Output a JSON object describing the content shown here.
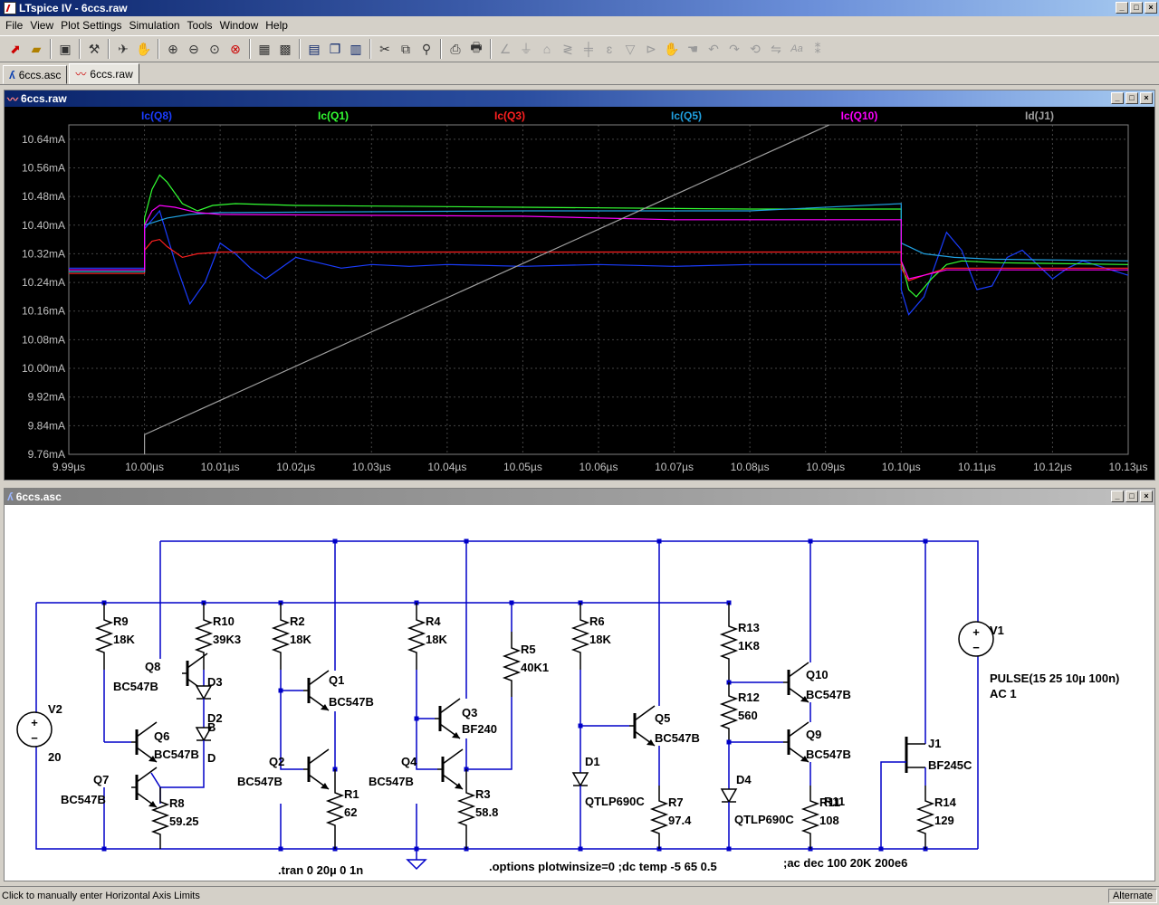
{
  "app": {
    "title": "LTspice IV - 6ccs.raw"
  },
  "menu": [
    "File",
    "View",
    "Plot Settings",
    "Simulation",
    "Tools",
    "Window",
    "Help"
  ],
  "toolbar_icons": [
    "new-schematic-icon",
    "open-icon",
    "save-icon",
    "control-panel-icon",
    "run-icon",
    "halt-icon",
    "zoom-in-icon",
    "zoom-out-icon",
    "zoom-fit-icon",
    "zoom-cancel-icon",
    "autorange-icon",
    "grid-icon",
    "tile-horizontal-icon",
    "cascade-icon",
    "tile-vertical-icon",
    "cut-icon",
    "copy-icon",
    "find-icon",
    "print-preview-icon",
    "print-icon",
    "wire-icon",
    "ground-icon",
    "label-icon",
    "resistor-icon",
    "capacitor-icon",
    "inductor-icon",
    "diode-icon",
    "component-icon",
    "move-icon",
    "drag-icon",
    "undo-icon",
    "redo-icon",
    "rotate-icon",
    "mirror-icon",
    "text-icon",
    "spice-directive-icon"
  ],
  "tabs": [
    {
      "label": "6ccs.asc",
      "icon": "schematic-icon"
    },
    {
      "label": "6ccs.raw",
      "icon": "waveform-icon"
    }
  ],
  "plot_window": {
    "title": "6ccs.raw"
  },
  "schematic_window": {
    "title": "6ccs.asc"
  },
  "chart_data": {
    "type": "line",
    "title": "",
    "xlabel": "",
    "ylabel": "",
    "x_ticks": [
      "9.99µs",
      "10.00µs",
      "10.01µs",
      "10.02µs",
      "10.03µs",
      "10.04µs",
      "10.05µs",
      "10.06µs",
      "10.07µs",
      "10.08µs",
      "10.09µs",
      "10.10µs",
      "10.11µs",
      "10.12µs",
      "10.13µs"
    ],
    "y_ticks": [
      "10.64mA",
      "10.56mA",
      "10.48mA",
      "10.40mA",
      "10.32mA",
      "10.24mA",
      "10.16mA",
      "10.08mA",
      "10.00mA",
      "9.92mA",
      "9.84mA",
      "9.76mA"
    ],
    "xlim_us": [
      9.99,
      10.13
    ],
    "ylim_mA": [
      9.76,
      10.68
    ],
    "grid": true,
    "background": "#000000",
    "series": [
      {
        "name": "Ic(Q8)",
        "color": "#1a3dff",
        "points": [
          [
            9.99,
            10.28
          ],
          [
            10.0,
            10.28
          ],
          [
            10.0,
            10.39
          ],
          [
            10.002,
            10.44
          ],
          [
            10.004,
            10.3
          ],
          [
            10.006,
            10.18
          ],
          [
            10.008,
            10.24
          ],
          [
            10.01,
            10.35
          ],
          [
            10.012,
            10.32
          ],
          [
            10.014,
            10.28
          ],
          [
            10.016,
            10.25
          ],
          [
            10.018,
            10.28
          ],
          [
            10.02,
            10.31
          ],
          [
            10.023,
            10.295
          ],
          [
            10.026,
            10.28
          ],
          [
            10.03,
            10.29
          ],
          [
            10.035,
            10.285
          ],
          [
            10.04,
            10.29
          ],
          [
            10.05,
            10.285
          ],
          [
            10.06,
            10.29
          ],
          [
            10.07,
            10.285
          ],
          [
            10.08,
            10.29
          ],
          [
            10.1,
            10.29
          ],
          [
            10.1,
            10.22
          ],
          [
            10.101,
            10.15
          ],
          [
            10.103,
            10.2
          ],
          [
            10.105,
            10.32
          ],
          [
            10.106,
            10.38
          ],
          [
            10.108,
            10.33
          ],
          [
            10.11,
            10.22
          ],
          [
            10.112,
            10.23
          ],
          [
            10.114,
            10.31
          ],
          [
            10.116,
            10.33
          ],
          [
            10.118,
            10.29
          ],
          [
            10.12,
            10.25
          ],
          [
            10.122,
            10.28
          ],
          [
            10.124,
            10.3
          ],
          [
            10.127,
            10.28
          ],
          [
            10.13,
            10.26
          ]
        ]
      },
      {
        "name": "Ic(Q1)",
        "color": "#33ff33",
        "points": [
          [
            9.99,
            10.27
          ],
          [
            10.0,
            10.27
          ],
          [
            10.0,
            10.42
          ],
          [
            10.001,
            10.5
          ],
          [
            10.002,
            10.54
          ],
          [
            10.003,
            10.52
          ],
          [
            10.005,
            10.46
          ],
          [
            10.007,
            10.44
          ],
          [
            10.009,
            10.455
          ],
          [
            10.012,
            10.46
          ],
          [
            10.02,
            10.455
          ],
          [
            10.05,
            10.45
          ],
          [
            10.08,
            10.445
          ],
          [
            10.1,
            10.445
          ],
          [
            10.1,
            10.3
          ],
          [
            10.101,
            10.22
          ],
          [
            10.102,
            10.2
          ],
          [
            10.104,
            10.25
          ],
          [
            10.106,
            10.29
          ],
          [
            10.108,
            10.3
          ],
          [
            10.113,
            10.295
          ],
          [
            10.13,
            10.29
          ]
        ]
      },
      {
        "name": "Ic(Q3)",
        "color": "#ff2020",
        "points": [
          [
            9.99,
            10.265
          ],
          [
            10.0,
            10.265
          ],
          [
            10.0,
            10.33
          ],
          [
            10.001,
            10.355
          ],
          [
            10.002,
            10.36
          ],
          [
            10.003,
            10.34
          ],
          [
            10.005,
            10.31
          ],
          [
            10.007,
            10.32
          ],
          [
            10.01,
            10.325
          ],
          [
            10.05,
            10.325
          ],
          [
            10.1,
            10.325
          ],
          [
            10.1,
            10.28
          ],
          [
            10.101,
            10.245
          ],
          [
            10.103,
            10.26
          ],
          [
            10.106,
            10.28
          ],
          [
            10.11,
            10.28
          ],
          [
            10.13,
            10.28
          ]
        ]
      },
      {
        "name": "Ic(Q5)",
        "color": "#20a0e0",
        "points": [
          [
            9.99,
            10.27
          ],
          [
            10.0,
            10.27
          ],
          [
            10.0,
            10.4
          ],
          [
            10.003,
            10.42
          ],
          [
            10.006,
            10.43
          ],
          [
            10.01,
            10.435
          ],
          [
            10.05,
            10.44
          ],
          [
            10.08,
            10.44
          ],
          [
            10.1,
            10.46
          ],
          [
            10.1,
            10.35
          ],
          [
            10.103,
            10.32
          ],
          [
            10.107,
            10.31
          ],
          [
            10.112,
            10.305
          ],
          [
            10.13,
            10.3
          ]
        ]
      },
      {
        "name": "Ic(Q10)",
        "color": "#ff00ff",
        "points": [
          [
            9.99,
            10.275
          ],
          [
            10.0,
            10.275
          ],
          [
            10.0,
            10.4
          ],
          [
            10.001,
            10.44
          ],
          [
            10.002,
            10.455
          ],
          [
            10.004,
            10.45
          ],
          [
            10.007,
            10.435
          ],
          [
            10.01,
            10.43
          ],
          [
            10.05,
            10.425
          ],
          [
            10.07,
            10.415
          ],
          [
            10.1,
            10.415
          ],
          [
            10.1,
            10.3
          ],
          [
            10.101,
            10.25
          ],
          [
            10.103,
            10.26
          ],
          [
            10.106,
            10.275
          ],
          [
            10.11,
            10.275
          ],
          [
            10.13,
            10.275
          ]
        ]
      },
      {
        "name": "Id(J1)",
        "color": "#a0a0a0",
        "points": [
          [
            10.0,
            9.76
          ],
          [
            10.0,
            9.815
          ],
          [
            10.0905,
            10.68
          ]
        ]
      }
    ]
  },
  "schematic": {
    "components": [
      {
        "ref": "R9",
        "value": "18K"
      },
      {
        "ref": "R10",
        "value": "39K3"
      },
      {
        "ref": "Q8",
        "value": "BC547B"
      },
      {
        "ref": "D3",
        "value": ""
      },
      {
        "ref": "D2",
        "value": "B"
      },
      {
        "ref": "D",
        "value": ""
      },
      {
        "ref": "Q6",
        "value": "BC547B"
      },
      {
        "ref": "Q7",
        "value": "BC547B"
      },
      {
        "ref": "R8",
        "value": "59.25"
      },
      {
        "ref": "V2",
        "value": "20"
      },
      {
        "ref": "R2",
        "value": "18K"
      },
      {
        "ref": "Q1",
        "value": "BC547B"
      },
      {
        "ref": "Q2",
        "value": "BC547B"
      },
      {
        "ref": "R1",
        "value": "62"
      },
      {
        "ref": "R4",
        "value": "18K"
      },
      {
        "ref": "R5",
        "value": "40K1"
      },
      {
        "ref": "Q3",
        "value": "BF240"
      },
      {
        "ref": "Q4",
        "value": "BC547B"
      },
      {
        "ref": "R3",
        "value": "58.8"
      },
      {
        "ref": "R6",
        "value": "18K"
      },
      {
        "ref": "Q5",
        "value": "BC547B"
      },
      {
        "ref": "D1",
        "value": "QTLP690C"
      },
      {
        "ref": "R7",
        "value": "97.4"
      },
      {
        "ref": "R13",
        "value": "1K8"
      },
      {
        "ref": "R12",
        "value": "560"
      },
      {
        "ref": "Q10",
        "value": "BC547B"
      },
      {
        "ref": "Q9",
        "value": "BC547B"
      },
      {
        "ref": "D4",
        "value": "QTLP690C"
      },
      {
        "ref": "R11",
        "value": "108"
      },
      {
        "ref": "V1",
        "value": "PULSE(15 25 10µ 100n)",
        "value2": "AC 1"
      },
      {
        "ref": "J1",
        "value": "BF245C"
      },
      {
        "ref": "R14",
        "value": "129"
      }
    ],
    "directives": [
      ".tran 0 20µ 0 1n",
      ".options plotwinsize=0  ;dc temp -5 65 0.5",
      ";ac dec 100 20K 200e6"
    ]
  },
  "status": {
    "left": "Click to manually enter Horizontal Axis Limits",
    "right": "Alternate"
  }
}
